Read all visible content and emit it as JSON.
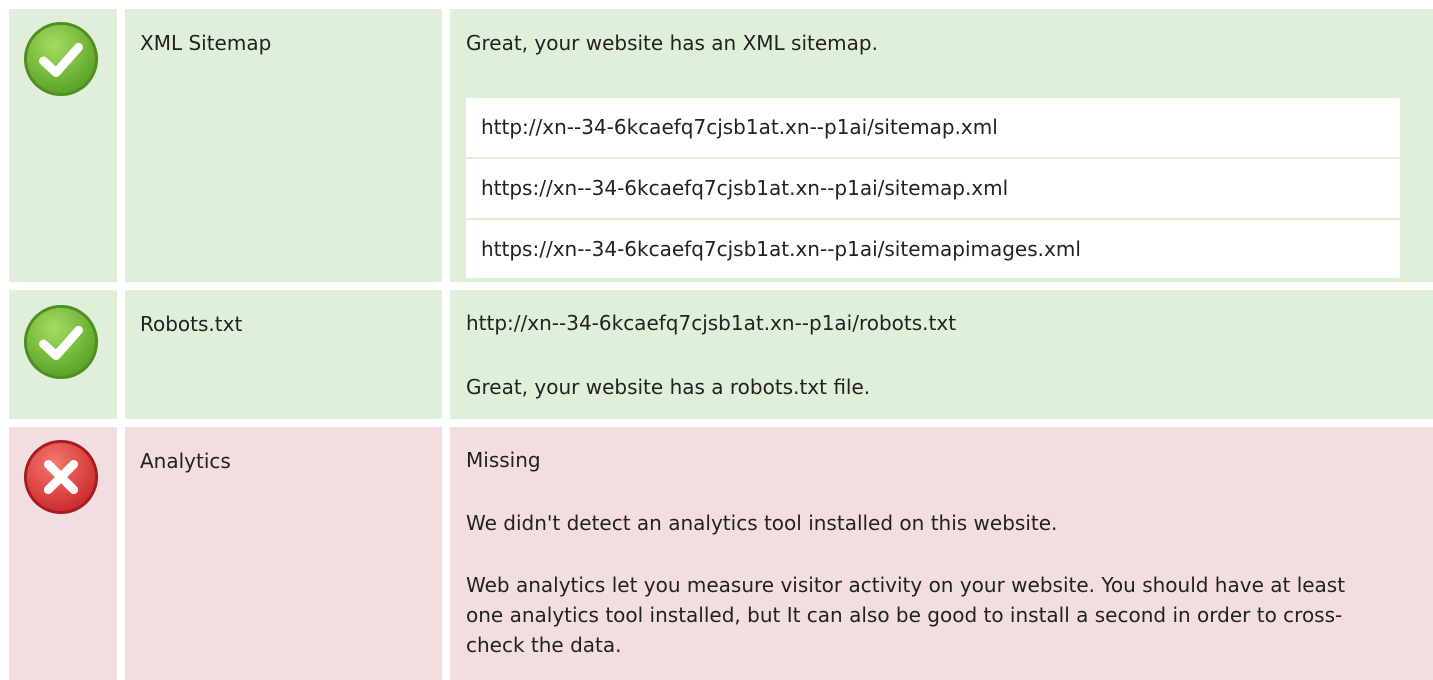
{
  "rows": [
    {
      "status": "pass",
      "status_icon": "check-circle-icon",
      "name": "XML Sitemap",
      "message": "Great, your website has an XML sitemap.",
      "urls": [
        "http://xn--34-6kcaefq7cjsb1at.xn--p1ai/sitemap.xml",
        "https://xn--34-6kcaefq7cjsb1at.xn--p1ai/sitemap.xml",
        "https://xn--34-6kcaefq7cjsb1at.xn--p1ai/sitemapimages.xml"
      ]
    },
    {
      "status": "pass",
      "status_icon": "check-circle-icon",
      "name": "Robots.txt",
      "url": "http://xn--34-6kcaefq7cjsb1at.xn--p1ai/robots.txt",
      "message": "Great, your website has a robots.txt file."
    },
    {
      "status": "fail",
      "status_icon": "x-circle-icon",
      "name": "Analytics",
      "value": "Missing",
      "message": "We didn't detect an analytics tool installed on this website.",
      "description": "Web analytics let you measure visitor activity on your website. You should have at least one analytics tool installed, but It can also be good to install a second in order to cross-check the data."
    }
  ],
  "colors": {
    "pass_bg": "#e0efd9",
    "fail_bg": "#f2dedf",
    "pass_icon": "#6cb33f",
    "fail_icon": "#d9383a"
  }
}
